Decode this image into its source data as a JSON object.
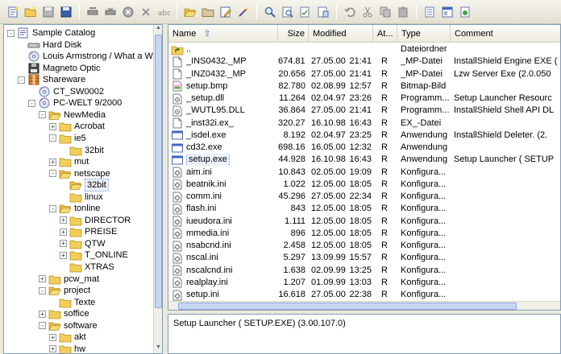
{
  "toolbar": {
    "icons": [
      "new-catalog-icon",
      "open-icon",
      "save-icon",
      "save-as-icon",
      "scan-disk-icon",
      "update-icon",
      "stop-icon",
      "delete-icon",
      "rename-icon",
      "folder-open-icon",
      "folder-up-icon",
      "edit-icon",
      "wand-icon",
      "find-icon",
      "find-next-icon",
      "report-icon",
      "export-icon",
      "undo-icon",
      "cut-icon",
      "copy-icon",
      "paste-icon",
      "properties-icon",
      "view-icon",
      "settings-icon"
    ]
  },
  "tree": {
    "nodes": [
      {
        "label": "Sample Catalog",
        "icon": "catalog-icon",
        "level": 0,
        "expander": "-"
      },
      {
        "label": "Hard Disk",
        "icon": "harddisk-icon",
        "level": 1,
        "expander": ""
      },
      {
        "label": "Louis Armstrong / What a Wonde",
        "icon": "cd-icon",
        "level": 1,
        "expander": ""
      },
      {
        "label": "Magneto Optic",
        "icon": "mo-disk-icon",
        "level": 1,
        "expander": ""
      },
      {
        "label": "Shareware",
        "icon": "archive-icon",
        "level": 1,
        "expander": "-"
      },
      {
        "label": "CT_SW0002",
        "icon": "cd-icon",
        "level": 2,
        "expander": ""
      },
      {
        "label": "PC-WELT 9/2000",
        "icon": "cd-icon",
        "level": 2,
        "expander": "-"
      },
      {
        "label": "NewMedia",
        "icon": "folder-open-icon",
        "level": 3,
        "expander": "-"
      },
      {
        "label": "Acrobat",
        "icon": "folder-icon",
        "level": 4,
        "expander": "+"
      },
      {
        "label": "ie5",
        "icon": "folder-icon",
        "level": 4,
        "expander": "-"
      },
      {
        "label": "32bit",
        "icon": "folder-icon",
        "level": 5,
        "expander": ""
      },
      {
        "label": "mut",
        "icon": "folder-icon",
        "level": 4,
        "expander": "+"
      },
      {
        "label": "netscape",
        "icon": "folder-open-icon",
        "level": 4,
        "expander": "-"
      },
      {
        "label": "32bit",
        "icon": "folder-open-icon",
        "level": 5,
        "expander": "",
        "selected": true
      },
      {
        "label": "linux",
        "icon": "folder-icon",
        "level": 5,
        "expander": ""
      },
      {
        "label": "tonline",
        "icon": "folder-open-icon",
        "level": 4,
        "expander": "-"
      },
      {
        "label": "DIRECTOR",
        "icon": "folder-icon",
        "level": 5,
        "expander": "+"
      },
      {
        "label": "PREISE",
        "icon": "folder-icon",
        "level": 5,
        "expander": "+"
      },
      {
        "label": "QTW",
        "icon": "folder-icon",
        "level": 5,
        "expander": "+"
      },
      {
        "label": "T_ONLINE",
        "icon": "folder-icon",
        "level": 5,
        "expander": "+"
      },
      {
        "label": "XTRAS",
        "icon": "folder-icon",
        "level": 5,
        "expander": ""
      },
      {
        "label": "pcw_mat",
        "icon": "folder-icon",
        "level": 3,
        "expander": "+"
      },
      {
        "label": "project",
        "icon": "folder-open-icon",
        "level": 3,
        "expander": "-"
      },
      {
        "label": "Texte",
        "icon": "folder-icon",
        "level": 4,
        "expander": ""
      },
      {
        "label": "soffice",
        "icon": "folder-icon",
        "level": 3,
        "expander": "+"
      },
      {
        "label": "software",
        "icon": "folder-open-icon",
        "level": 3,
        "expander": "-"
      },
      {
        "label": "akt",
        "icon": "folder-icon",
        "level": 4,
        "expander": "+"
      },
      {
        "label": "hw",
        "icon": "folder-icon",
        "level": 4,
        "expander": "+"
      }
    ]
  },
  "list": {
    "columns": [
      "Name",
      "Size",
      "Modified",
      "At...",
      "Type",
      "Comment"
    ],
    "rows": [
      {
        "name": "..",
        "size": "",
        "date": "",
        "time": "",
        "attr": "",
        "type": "Dateiordner",
        "comment": "",
        "icon": "folder-up-icon"
      },
      {
        "name": "_INS0432._MP",
        "size": "674.816",
        "date": "27.05.00",
        "time": "21:41",
        "attr": "R",
        "type": "_MP-Datei",
        "comment": "InstallShield Engine EXE (",
        "icon": "file-icon"
      },
      {
        "name": "_INZ0432._MP",
        "size": "20.656",
        "date": "27.05.00",
        "time": "21:41",
        "attr": "R",
        "type": "_MP-Datei",
        "comment": "Lzw Server Exe (2.0.050",
        "icon": "file-icon"
      },
      {
        "name": "setup.bmp",
        "size": "82.780",
        "date": "02.08.99",
        "time": "12:57",
        "attr": "R",
        "type": "Bitmap-Bild",
        "comment": "",
        "icon": "bitmap-icon"
      },
      {
        "name": "_setup.dll",
        "size": "11.264",
        "date": "02.04.97",
        "time": "23:26",
        "attr": "R",
        "type": "Programm...",
        "comment": "Setup Launcher Resourc",
        "icon": "dll-icon"
      },
      {
        "name": "_WUTL95.DLL",
        "size": "36.864",
        "date": "27.05.00",
        "time": "21:41",
        "attr": "R",
        "type": "Programm...",
        "comment": "InstallShield Shell API DL",
        "icon": "dll-icon"
      },
      {
        "name": "_inst32i.ex_",
        "size": "320.276",
        "date": "16.10.98",
        "time": "16:43",
        "attr": "R",
        "type": "EX_-Datei",
        "comment": "",
        "icon": "file-icon"
      },
      {
        "name": "_isdel.exe",
        "size": "8.192",
        "date": "02.04.97",
        "time": "23:25",
        "attr": "R",
        "type": "Anwendung",
        "comment": "InstallShield Deleter. (2.",
        "icon": "exe-icon"
      },
      {
        "name": "cd32.exe",
        "size": "698.168",
        "date": "16.05.00",
        "time": "12:32",
        "attr": "R",
        "type": "Anwendung",
        "comment": "",
        "icon": "exe-icon"
      },
      {
        "name": "setup.exe",
        "size": "44.928",
        "date": "16.10.98",
        "time": "16:43",
        "attr": "R",
        "type": "Anwendung",
        "comment": "Setup Launcher ( SETUP",
        "icon": "exe-icon",
        "selected": true
      },
      {
        "name": "aim.ini",
        "size": "10.843",
        "date": "02.05.00",
        "time": "19:09",
        "attr": "R",
        "type": "Konfigura...",
        "comment": "",
        "icon": "ini-icon"
      },
      {
        "name": "beatnik.ini",
        "size": "1.022",
        "date": "12.05.00",
        "time": "18:05",
        "attr": "R",
        "type": "Konfigura...",
        "comment": "",
        "icon": "ini-icon"
      },
      {
        "name": "comm.ini",
        "size": "45.296",
        "date": "27.05.00",
        "time": "22:34",
        "attr": "R",
        "type": "Konfigura...",
        "comment": "",
        "icon": "ini-icon"
      },
      {
        "name": "flash.ini",
        "size": "843",
        "date": "12.05.00",
        "time": "18:05",
        "attr": "R",
        "type": "Konfigura...",
        "comment": "",
        "icon": "ini-icon"
      },
      {
        "name": "iueudora.ini",
        "size": "1.111",
        "date": "12.05.00",
        "time": "18:05",
        "attr": "R",
        "type": "Konfigura...",
        "comment": "",
        "icon": "ini-icon"
      },
      {
        "name": "mmedia.ini",
        "size": "896",
        "date": "12.05.00",
        "time": "18:05",
        "attr": "R",
        "type": "Konfigura...",
        "comment": "",
        "icon": "ini-icon"
      },
      {
        "name": "nsabcnd.ini",
        "size": "2.458",
        "date": "12.05.00",
        "time": "18:05",
        "attr": "R",
        "type": "Konfigura...",
        "comment": "",
        "icon": "ini-icon"
      },
      {
        "name": "nscal.ini",
        "size": "5.297",
        "date": "13.09.99",
        "time": "15:57",
        "attr": "R",
        "type": "Konfigura...",
        "comment": "",
        "icon": "ini-icon"
      },
      {
        "name": "nscalcnd.ini",
        "size": "1.638",
        "date": "02.09.99",
        "time": "13:25",
        "attr": "R",
        "type": "Konfigura...",
        "comment": "",
        "icon": "ini-icon"
      },
      {
        "name": "realplay.ini",
        "size": "1.207",
        "date": "01.09.99",
        "time": "13:03",
        "attr": "R",
        "type": "Konfigura...",
        "comment": "",
        "icon": "ini-icon"
      },
      {
        "name": "setup.ini",
        "size": "16.618",
        "date": "27.05.00",
        "time": "22:38",
        "attr": "R",
        "type": "Konfigura...",
        "comment": "",
        "icon": "ini-icon"
      }
    ]
  },
  "description": {
    "text": "Setup Launcher ( SETUP.EXE)  (3.00.107.0)"
  },
  "colors": {
    "folder": "#f0c84a",
    "accent": "#316ac5",
    "border": "#7f9db9"
  }
}
